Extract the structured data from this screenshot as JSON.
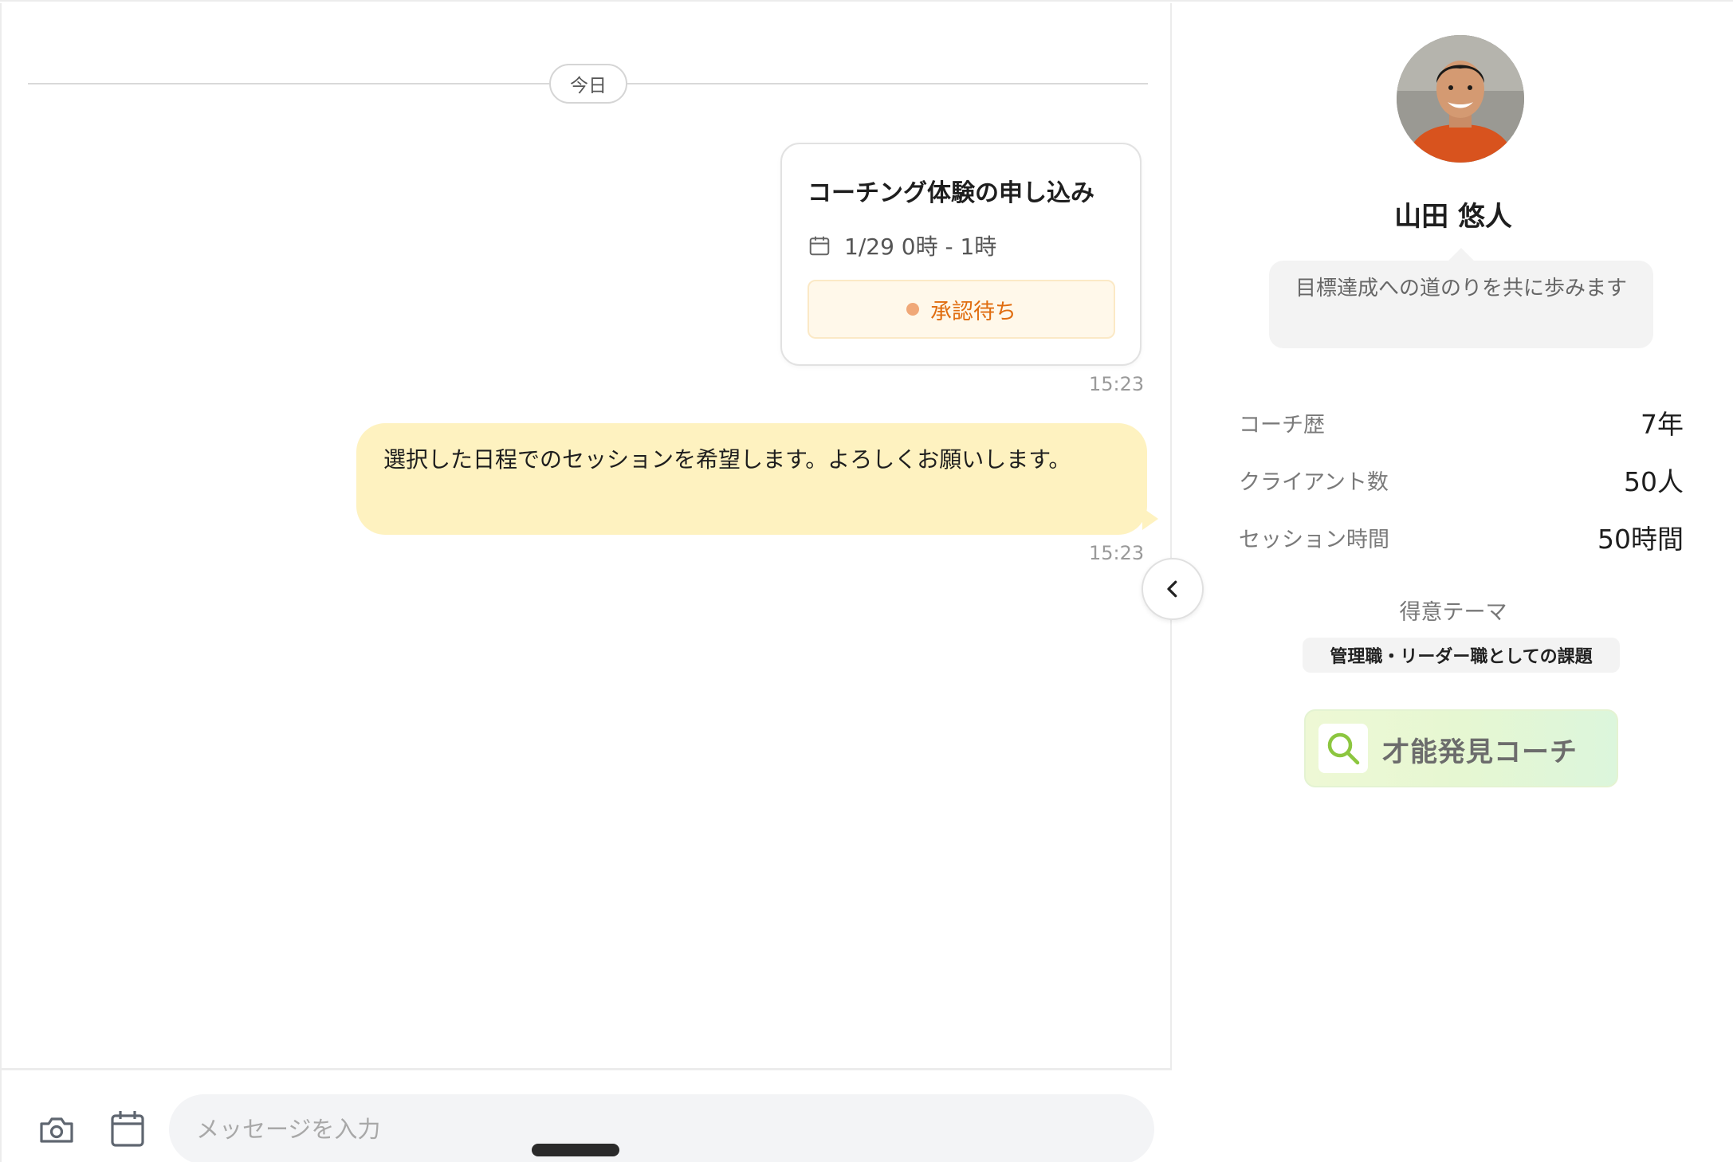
{
  "chat": {
    "date_separator": "今日",
    "booking_card": {
      "title": "コーチング体験の申し込み",
      "datetime": "1/29 0時 - 1時",
      "status": "承認待ち",
      "time": "15:23"
    },
    "message": {
      "text": "選択した日程でのセッションを希望します。よろしくお願いします。",
      "time": "15:23"
    },
    "composer": {
      "placeholder": "メッセージを入力"
    }
  },
  "profile": {
    "name": "山田 悠人",
    "bio": "目標達成への道のりを共に歩みます",
    "stats": [
      {
        "label": "コーチ歴",
        "value": "7年"
      },
      {
        "label": "クライアント数",
        "value": "50人"
      },
      {
        "label": "セッション時間",
        "value": "50時間"
      }
    ],
    "themes_label": "得意テーマ",
    "themes": [
      "管理職・リーダー職としての課題"
    ],
    "badge_label": "才能発見コーチ"
  },
  "colors": {
    "bubble": "#fef2c0",
    "status_text": "#e06d10",
    "status_bg": "#fff8ea",
    "badge_gradient_start": "#eef8d5",
    "badge_gradient_end": "#dcf6dc",
    "badge_icon": "#8cc63f"
  },
  "icons": {
    "calendar": "calendar-icon",
    "camera": "camera-icon",
    "collapse": "chevron-left-icon",
    "badge": "magnifier-icon"
  }
}
